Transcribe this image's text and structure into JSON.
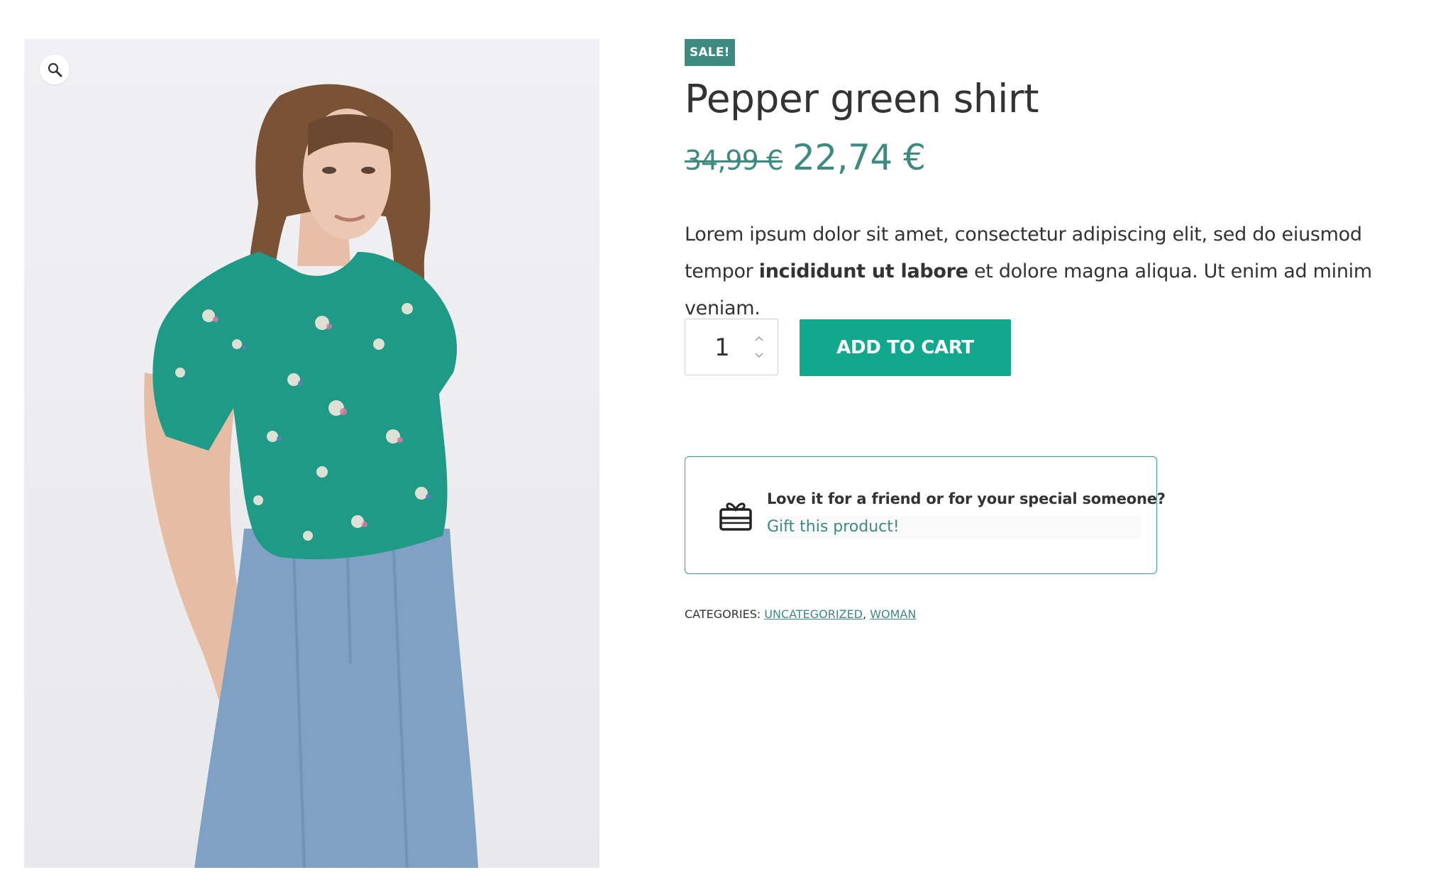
{
  "product": {
    "badge": "SALE!",
    "title": "Pepper green shirt",
    "price_old": "34,99 €",
    "price_new": "22,74 €",
    "description_part1": "Lorem ipsum dolor sit amet, consectetur adipiscing elit, sed do eiusmod tempor",
    "description_bold": "incididunt ut labore",
    "description_part2": " et dolore magna aliqua. Ut enim ad minim veniam."
  },
  "cart": {
    "quantity": "1",
    "add_to_cart_label": "ADD TO CART"
  },
  "gift": {
    "title": "Love it for a friend or for your special someone?",
    "link_label": "Gift this product!"
  },
  "categories": {
    "label": "CATEGORIES:",
    "separator": ",",
    "items": [
      "UNCATEGORIZED",
      "WOMAN"
    ]
  },
  "gallery": {
    "zoom_icon": "magnifier-icon",
    "colors": {
      "shirt": "#1f9a86",
      "jeans": "#7fa2c4",
      "hair": "#7a5236",
      "skin": "#e9c3ac"
    }
  },
  "colors": {
    "accent": "#3d8a80",
    "button": "#12a88e",
    "text": "#333333"
  }
}
